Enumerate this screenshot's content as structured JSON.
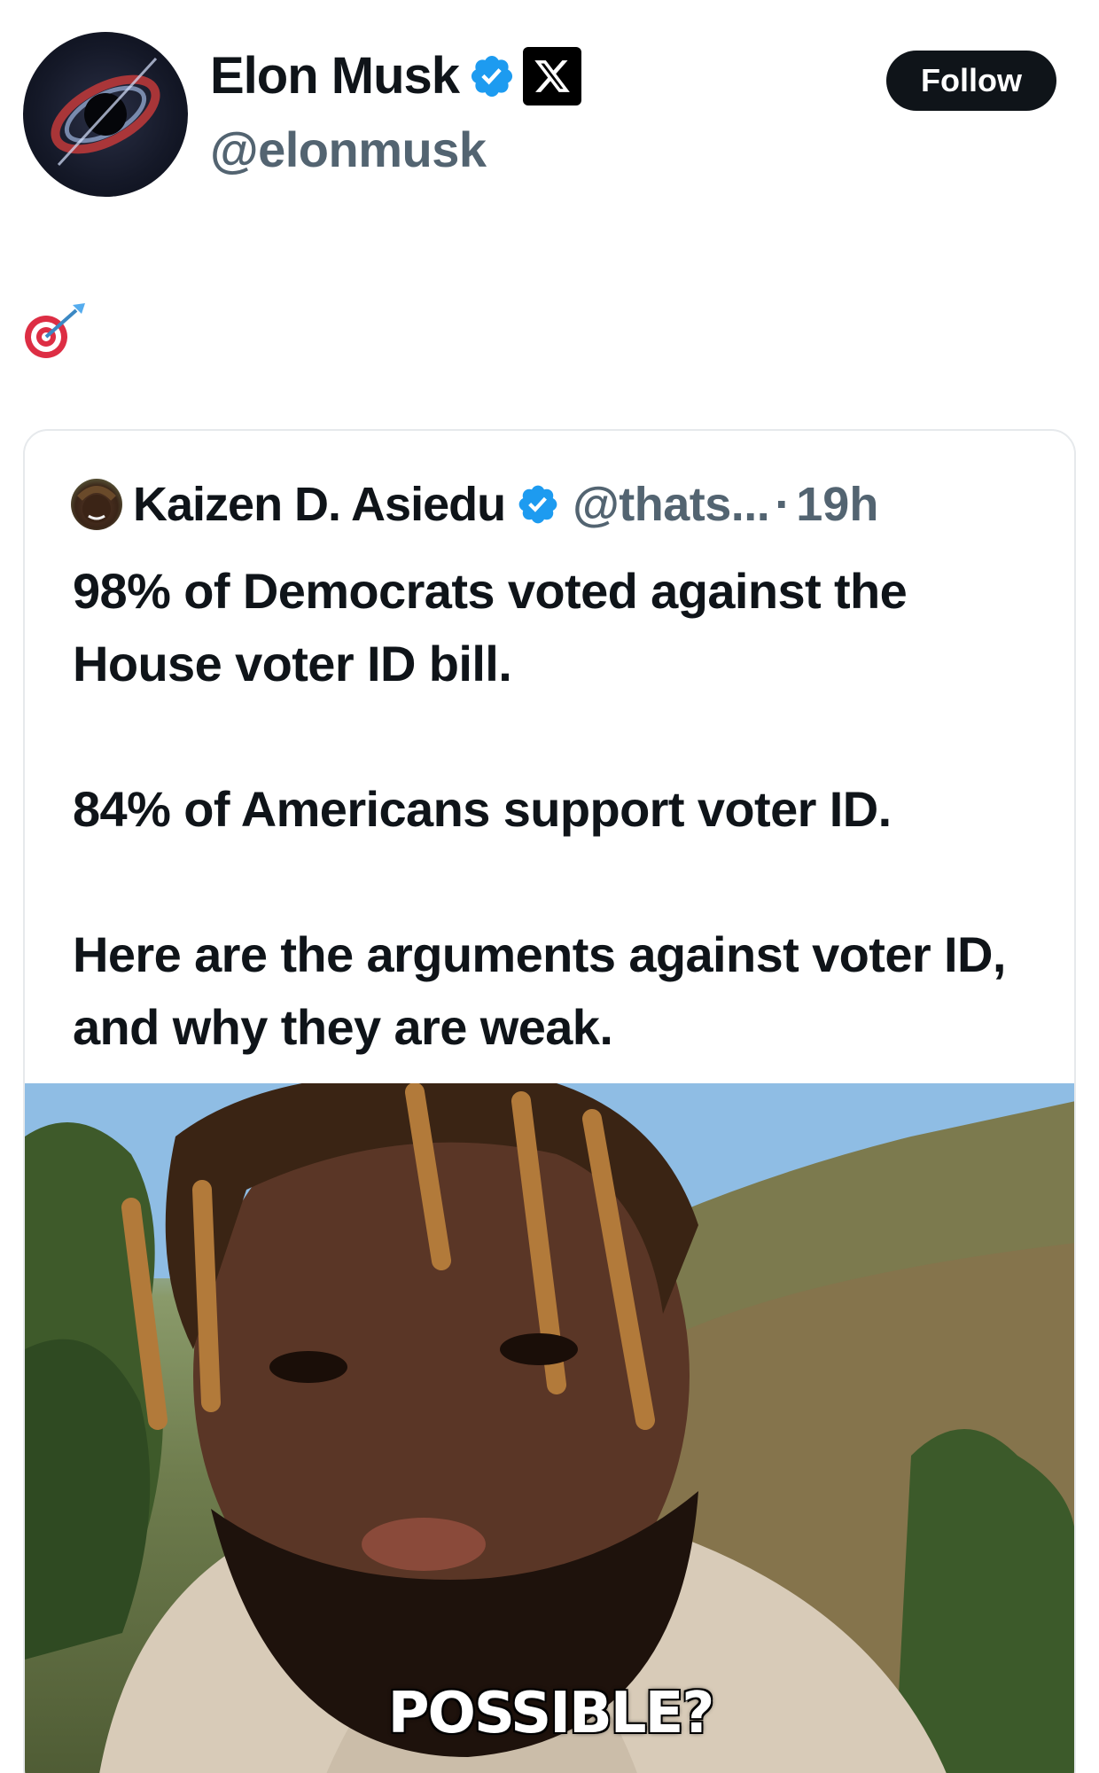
{
  "post": {
    "author_name": "Elon Musk",
    "author_handle": "@elonmusk",
    "follow_label": "Follow",
    "body_emoji": "direct-hit-emoji"
  },
  "quoted": {
    "author_name": "Kaizen D. Asiedu",
    "author_handle": "@thats...",
    "separator": "·",
    "time": "19h",
    "paragraphs": [
      "98% of Democrats voted against the House voter ID bill.",
      "84% of Americans support voter ID.",
      "Here are the arguments against voter ID, and why they are weak."
    ],
    "video_caption": "POSSIBLE?"
  },
  "colors": {
    "verified_blue": "#1d9bf0",
    "secondary_text": "#536471",
    "button_bg": "#0f1419"
  }
}
